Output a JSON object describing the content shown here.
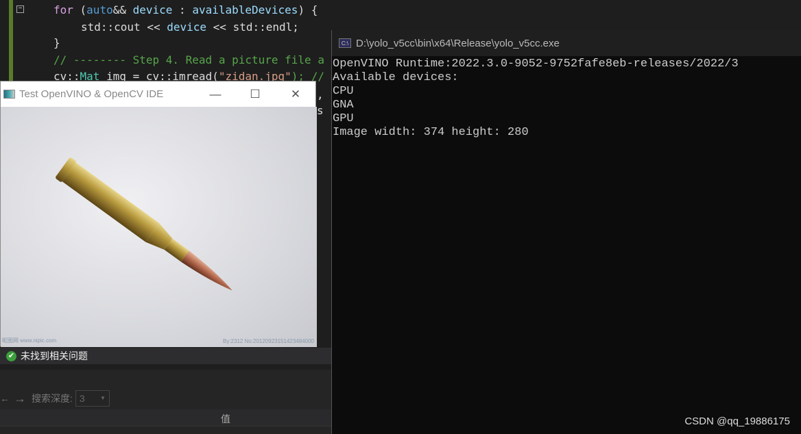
{
  "editor": {
    "lines": [
      [
        "for",
        " (",
        "auto",
        "&& ",
        "device",
        " : ",
        "availableDevices",
        ") {"
      ],
      [
        "std::cout << ",
        "device",
        " << std::endl;"
      ],
      [
        "}"
      ],
      [
        "// -------- Step 4. Read a picture file a"
      ],
      [
        "cv::",
        "Mat",
        " img = cv::imread(",
        "\"zidan.jpg\"",
        "); //"
      ]
    ],
    "frag1": ",",
    "frag2": "s"
  },
  "image_window": {
    "title": "Test OpenVINO & OpenCV IDE",
    "minimize": "—",
    "maximize": "☐",
    "close": "✕",
    "watermark_left": "昵图网 www.nipic.com",
    "watermark_right": "By:2312 No:20120923151423484000"
  },
  "status_bar": {
    "text": "未找到相关问题",
    "icon": "check-circle-icon"
  },
  "search": {
    "label": "搜索深度:",
    "depth": "3"
  },
  "table_header": {
    "value_col": "值"
  },
  "console": {
    "title": "D:\\yolo_v5cc\\bin\\x64\\Release\\yolo_v5cc.exe",
    "icon_label": "C:\\",
    "output": [
      "OpenVINO Runtime:2022.3.0-9052-9752fafe8eb-releases/2022/3",
      "Available devices:",
      "CPU",
      "GNA",
      "GPU",
      "Image width: 374 height: 280"
    ]
  },
  "watermark": "CSDN @qq_19886175"
}
